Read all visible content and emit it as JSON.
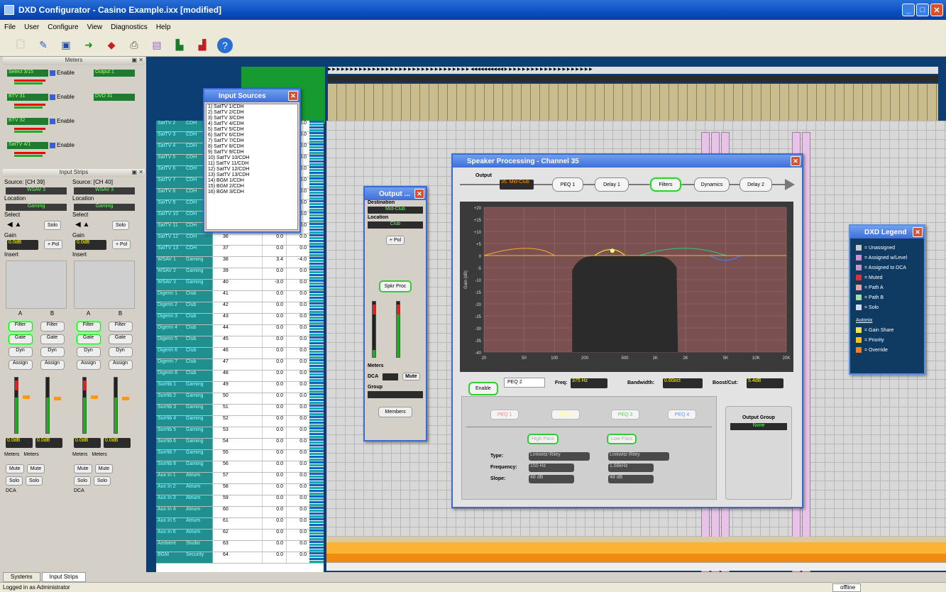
{
  "window": {
    "title": "DXD Configurator - Casino Example.ixx [modified]"
  },
  "menu": [
    "File",
    "User",
    "Configure",
    "View",
    "Diagnostics",
    "Help"
  ],
  "toolbar_icons": [
    "new-icon",
    "open-icon",
    "save-icon",
    "arrow-right-icon",
    "arrow-left-icon",
    "print-icon",
    "clipboard-icon",
    "plug-in-icon",
    "plug-out-icon",
    "help-icon"
  ],
  "meters_panel": {
    "title": "Meters",
    "rows": [
      {
        "left": "Select 3/15",
        "enable": "Enable",
        "right": "Output 1"
      },
      {
        "left": "BTV 31",
        "enable": "Enable",
        "right": "DVD 31"
      },
      {
        "left": "BTV 32",
        "enable": "Enable",
        "right": ""
      },
      {
        "left": "SatTV 4/1",
        "enable": "Enable",
        "right": ""
      }
    ]
  },
  "input_strips": {
    "title": "Input Strips",
    "strips": [
      {
        "source": "Source: [CH 39]",
        "name": "WSAV 3",
        "location_label": "Location",
        "location": "Gaming",
        "select": "Select",
        "solo": "Solo",
        "gain": "Gain",
        "gain_value": "0.0dB",
        "phase": "+ Pol",
        "insert": "Insert",
        "a": "A",
        "b": "B",
        "filter": "Filter",
        "gate": "Gate",
        "dyn": "Dyn",
        "assign": "Assign",
        "level": "0.0dB",
        "meters": "Meters",
        "mute": "Mute",
        "solo2": "Solo",
        "dca": "DCA"
      },
      {
        "source": "Source: [CH 40]",
        "name": "WSAV 3",
        "location_label": "Location",
        "location": "Gaming",
        "select": "Select",
        "solo": "Solo",
        "gain": "Gain",
        "gain_value": "0.0dB",
        "phase": "+ Pol",
        "insert": "Insert",
        "a": "A",
        "b": "B",
        "filter": "Filter",
        "gate": "Gate",
        "dyn": "Dyn",
        "assign": "Assign",
        "level": "0.0dB",
        "meters": "Meters",
        "mute": "Mute",
        "solo2": "Solo",
        "dca": "DCA"
      }
    ]
  },
  "bottom_tabs": [
    "Systems",
    "Input Strips"
  ],
  "status": {
    "left": "Logged in as Administrator",
    "right": "offline"
  },
  "channel_rows": [
    [
      "SatTV 2",
      "CDH",
      "30",
      "0.0",
      "0.0"
    ],
    [
      "SatTV 3",
      "CDH",
      "31",
      "0.0",
      "0.0"
    ],
    [
      "SatTV 4",
      "CDH",
      "32",
      "0.0",
      "0.0"
    ],
    [
      "SatTV 5",
      "CDH",
      "33",
      "0.0",
      "0.0"
    ],
    [
      "SatTV 6",
      "CDH",
      "34",
      "0.0",
      "0.0"
    ],
    [
      "SatTV 7",
      "CDH",
      "35",
      "0.0",
      "0.0"
    ],
    [
      "SatTV 8",
      "CDH",
      "36",
      "0.0",
      "0.0"
    ],
    [
      "SatTV 9",
      "CDH",
      "37",
      "0.0",
      "0.0"
    ],
    [
      "SatTV 10",
      "CDH",
      "38",
      "0.0",
      "0.0"
    ],
    [
      "SatTV 11",
      "CDH",
      "39",
      "0.0",
      "0.0"
    ],
    [
      "SatTV 12",
      "CDH",
      "36",
      "0.0",
      "0.0"
    ],
    [
      "SatTV 13",
      "CDH",
      "37",
      "0.0",
      "0.0"
    ],
    [
      "WSAV 1",
      "Gaming",
      "38",
      "3.4",
      "-4.0"
    ],
    [
      "WSAV 2",
      "Gaming",
      "39",
      "0.0",
      "0.0"
    ],
    [
      "WSAV 3",
      "Gaming",
      "40",
      "-3.0",
      "0.0"
    ],
    [
      "Digerin 1",
      "Club",
      "41",
      "0.0",
      "0.0"
    ],
    [
      "Digerin 2",
      "Club",
      "42",
      "0.0",
      "0.0"
    ],
    [
      "Digerin 3",
      "Club",
      "43",
      "0.0",
      "0.0"
    ],
    [
      "Digerin 4",
      "Club",
      "44",
      "0.0",
      "0.0"
    ],
    [
      "Digerin 5",
      "Club",
      "45",
      "0.0",
      "0.0"
    ],
    [
      "Digerin 6",
      "Club",
      "46",
      "0.0",
      "0.0"
    ],
    [
      "Digerin 7",
      "Club",
      "47",
      "0.0",
      "0.0"
    ],
    [
      "Digerin 8",
      "Club",
      "48",
      "0.0",
      "0.0"
    ],
    [
      "Surrlib 1",
      "Gaming",
      "49",
      "0.0",
      "0.0"
    ],
    [
      "Surrlib 2",
      "Gaming",
      "50",
      "0.0",
      "0.0"
    ],
    [
      "Surrlib 3",
      "Gaming",
      "51",
      "0.0",
      "0.0"
    ],
    [
      "Surrlib 4",
      "Gaming",
      "52",
      "0.0",
      "0.0"
    ],
    [
      "Surrlib 5",
      "Gaming",
      "53",
      "0.0",
      "0.0"
    ],
    [
      "Surrlib 6",
      "Gaming",
      "54",
      "0.0",
      "0.0"
    ],
    [
      "Surrlib 7",
      "Gaming",
      "55",
      "0.0",
      "0.0"
    ],
    [
      "Surrlib 8",
      "Gaming",
      "56",
      "0.0",
      "0.0"
    ],
    [
      "Aux In 1",
      "Atrium",
      "57",
      "0.0",
      "0.0"
    ],
    [
      "Aux In 2",
      "Atrium",
      "58",
      "0.0",
      "0.0"
    ],
    [
      "Aux In 3",
      "Atrium",
      "59",
      "0.0",
      "0.0"
    ],
    [
      "Aux In 4",
      "Atrium",
      "60",
      "0.0",
      "0.0"
    ],
    [
      "Aux In 5",
      "Atrium",
      "61",
      "0.0",
      "0.0"
    ],
    [
      "Aux In 6",
      "Atrium",
      "62",
      "0.0",
      "0.0"
    ],
    [
      "Ambient",
      "Studio",
      "63",
      "0.0",
      "0.0"
    ],
    [
      "BGM",
      "Security",
      "64",
      "0.0",
      "0.0"
    ]
  ],
  "input_sources": {
    "title": "Input Sources",
    "items": [
      "1) SatTV 1/CDH",
      "2) SatTV 2/CDH",
      "3) SatTV 3/CDH",
      "4) SatTV 4/CDH",
      "5) SatTV 5/CDH",
      "6) SatTV 6/CDH",
      "7) SatTV 7/CDH",
      "8) SatTV 8/CDH",
      "9) SatTV 9/CDH",
      "10) SatTV 10/CDH",
      "11) SatTV 11/CDH",
      "12) SatTV 12/CDH",
      "13) SatTV 13/CDH",
      "14) BGM 1/CDH",
      "15) BGM 2/CDH",
      "16) BGM 3/CDH"
    ]
  },
  "output_window": {
    "title": "Output ...",
    "destination_label": "Destination",
    "destination": "Mid-Club",
    "location_label": "Location",
    "location": "Club",
    "phase": "+ Pol",
    "spkr_proc": "Spkr Proc",
    "meters": "Meters",
    "dca_label": "DCA",
    "mute": "Mute",
    "group_label": "Group",
    "members": "Members"
  },
  "speaker_proc": {
    "title": "Speaker Processing - Channel 35",
    "output_label": "Output",
    "output_value": "35. Mid-Club",
    "chain": [
      "PEQ 1",
      "Delay 1",
      "Filters",
      "Dynamics",
      "Delay 2"
    ],
    "enable": "Enable",
    "peq_name": "PEQ 2",
    "freq_label": "Freq:",
    "freq_value": "375 Hz",
    "bw_label": "Bandwidth:",
    "bw_value": "0.60oct",
    "boost_label": "Boost/Cut:",
    "boost_value": "5.4dB",
    "peq_buttons": [
      "PEQ 1",
      "PEQ 2",
      "PEQ 3",
      "PEQ 4"
    ],
    "high_pass": "High Pass",
    "low_pass": "Low Pass",
    "type_label": "Type:",
    "freq2_label": "Frequency:",
    "slope_label": "Slope:",
    "hp_type": "Linkwitz-Riley",
    "hp_freq": "150 Hz",
    "hp_slope": "48 dB",
    "lp_type": "Linkwitz-Riley",
    "lp_freq": "1.68kHz",
    "lp_slope": "48 dB",
    "output_group_label": "Output Group",
    "output_group_value": "None",
    "plot_ylabel": "Gain (dB)",
    "plot_x_ticks": [
      "20",
      "50",
      "100",
      "200",
      "500",
      "1K",
      "2K",
      "5K",
      "10K",
      "20K"
    ],
    "plot_y_ticks": [
      "+20",
      "+15",
      "+10",
      "+5",
      "0",
      "-5",
      "-10",
      "-15",
      "-20",
      "-25",
      "-30",
      "-35",
      "-40"
    ]
  },
  "legend": {
    "title": "DXD Legend",
    "items": [
      {
        "label": "= Unassigned",
        "color": "#c8c8c8"
      },
      {
        "label": "= Assigned w/Level",
        "color": "#d48bd4"
      },
      {
        "label": "= Assigned to DCA",
        "color": "#c894c8"
      },
      {
        "label": "= Muted",
        "color": "#e03030"
      },
      {
        "label": "= Path A",
        "color": "#f0a0a0"
      },
      {
        "label": "= Path B",
        "color": "#a0e0a0"
      },
      {
        "label": "= Solo",
        "color": "#d8d8f8"
      },
      {
        "label": "Autonix",
        "color": ""
      },
      {
        "label": "= Gain Share",
        "color": "#f5e34b"
      },
      {
        "label": "= Priority",
        "color": "#f0c020"
      },
      {
        "label": "= Override",
        "color": "#f08020"
      }
    ]
  }
}
